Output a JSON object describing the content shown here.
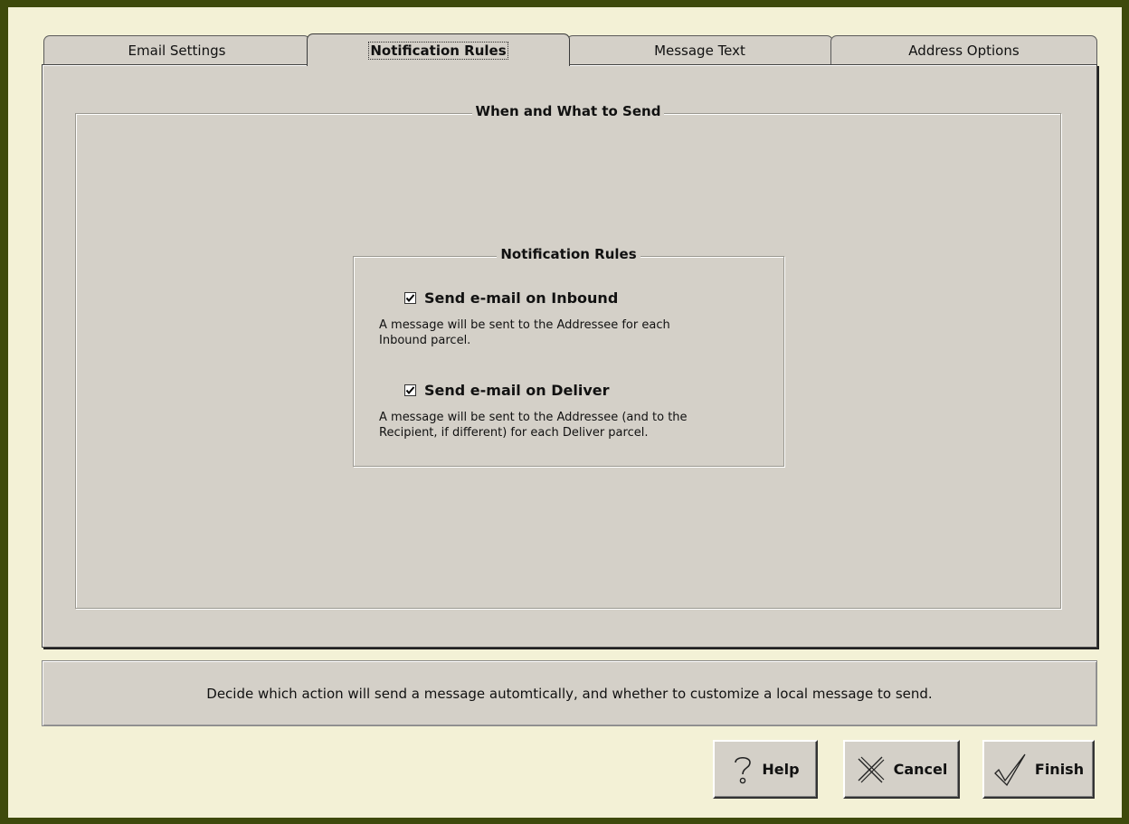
{
  "tabs": [
    {
      "label": "Email Settings"
    },
    {
      "label": "Notification Rules"
    },
    {
      "label": "Message Text"
    },
    {
      "label": "Address Options"
    }
  ],
  "outer_group": {
    "title": "When and What to Send"
  },
  "inner_group": {
    "title": "Notification Rules"
  },
  "rules": [
    {
      "label": "Send e-mail on Inbound",
      "checked": true,
      "desc_line1": "A message will be sent to the Addressee for each",
      "desc_line2": "Inbound parcel."
    },
    {
      "label": "Send e-mail on Deliver",
      "checked": true,
      "desc_line1": "A message will be sent to the Addressee (and to the",
      "desc_line2": "Recipient, if different) for each Deliver parcel."
    }
  ],
  "hint": "Decide which action will send a message automtically, and whether to customize a local message to send.",
  "buttons": {
    "help": "Help",
    "cancel": "Cancel",
    "finish": "Finish"
  },
  "icons": {
    "help": "help-icon",
    "cancel": "cancel-icon",
    "finish": "finish-icon",
    "check": "checkmark-icon"
  },
  "colors": {
    "window_bg": "#f3f1d6",
    "panel_bg": "#d4d0c8",
    "outer_border": "#3e4a0c"
  }
}
